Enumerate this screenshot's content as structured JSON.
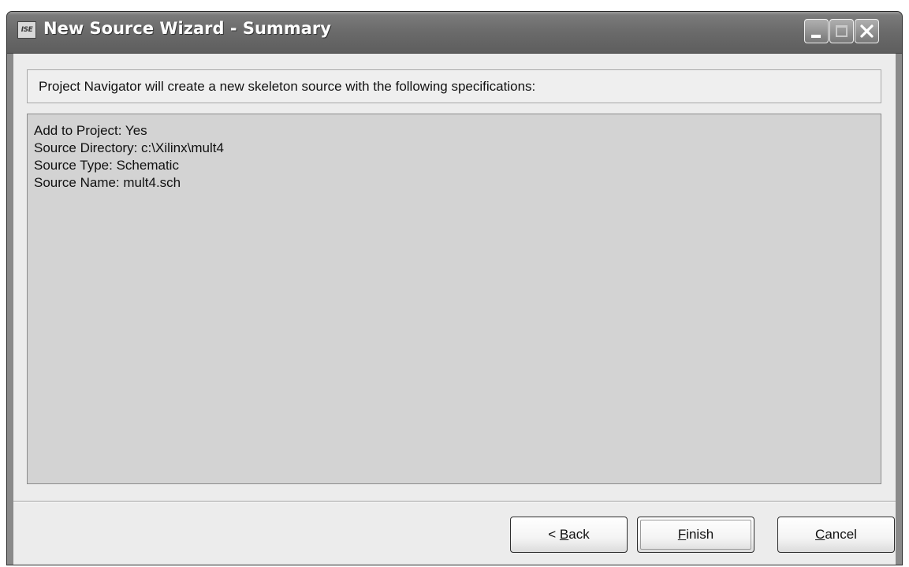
{
  "window": {
    "title": "New Source Wizard - Summary",
    "app_icon_text": "ISE",
    "controls": {
      "minimize": "minimize-icon",
      "maximize": "maximize-icon",
      "close": "close-icon"
    }
  },
  "header": {
    "text": "Project Navigator will create a new skeleton source with the following specifications:"
  },
  "specs": [
    "Add to Project: Yes",
    "Source Directory: c:\\Xilinx\\mult4",
    "Source Type: Schematic",
    "Source Name: mult4.sch"
  ],
  "buttons": {
    "back": {
      "prefix": "< ",
      "accel": "B",
      "rest": "ack"
    },
    "finish": {
      "accel": "F",
      "rest": "inish"
    },
    "cancel": {
      "accel": "C",
      "rest": "ancel"
    }
  },
  "colors": {
    "titlebar": "#6a6a6a",
    "client_background": "#ececec",
    "spec_background": "#d3d3d3"
  }
}
